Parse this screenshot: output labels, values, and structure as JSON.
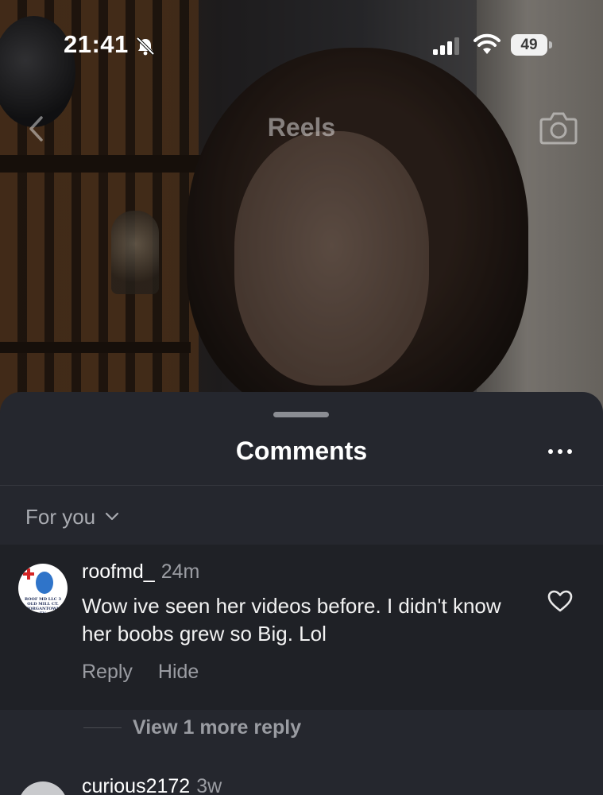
{
  "status_bar": {
    "time": "21:41",
    "battery": "49",
    "icons": [
      "bell-slash-icon",
      "cellular-signal-icon",
      "wifi-icon",
      "battery-icon"
    ]
  },
  "header": {
    "title": "Reels",
    "back_icon": "chevron-left-icon",
    "camera_icon": "camera-icon"
  },
  "comments_sheet": {
    "title": "Comments",
    "more_icon": "more-horizontal-icon",
    "sort": {
      "label": "For you",
      "icon": "chevron-down-icon"
    },
    "comments": [
      {
        "username": "roofmd_",
        "time": "24m",
        "text": "Wow ive seen her videos before. I didn't know her boobs grew so Big. Lol",
        "actions": [
          "Reply",
          "Hide"
        ],
        "avatar_text": "ROOF MD LLC 3 OLD MILL CT. MORGANTOWN, TN",
        "like_icon": "heart-icon",
        "view_replies": "View 1 more reply"
      },
      {
        "username": "curious2172",
        "time": "3w"
      }
    ]
  },
  "colors": {
    "sheet_bg": "#25272e",
    "highlight_bg": "#1f2126",
    "muted_text": "#9a9ca2"
  }
}
